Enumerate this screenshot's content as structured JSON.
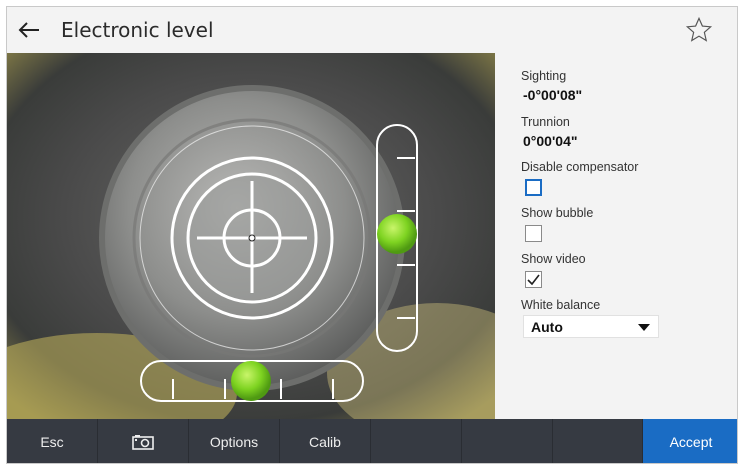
{
  "header": {
    "title": "Electronic level",
    "back_icon": "arrow-left-icon",
    "favorite_icon": "star-outline-icon"
  },
  "panel": {
    "sighting_label": "Sighting",
    "sighting_value": "-0°00'08\"",
    "trunnion_label": "Trunnion",
    "trunnion_value": "0°00'04\"",
    "disable_compensator_label": "Disable compensator",
    "disable_compensator_checked": false,
    "show_bubble_label": "Show bubble",
    "show_bubble_checked": false,
    "show_video_label": "Show video",
    "show_video_checked": true,
    "white_balance_label": "White balance",
    "white_balance_value": "Auto"
  },
  "toolbar": {
    "esc_label": "Esc",
    "camera_icon": "camera-icon",
    "options_label": "Options",
    "calib_label": "Calib",
    "accept_label": "Accept"
  },
  "colors": {
    "accent": "#1a6cc4",
    "toolbar_bg": "#363a42",
    "bubble": "#7ed321"
  },
  "levels": {
    "vertical_bubble_fraction": 0.45,
    "horizontal_bubble_fraction": 0.5
  }
}
